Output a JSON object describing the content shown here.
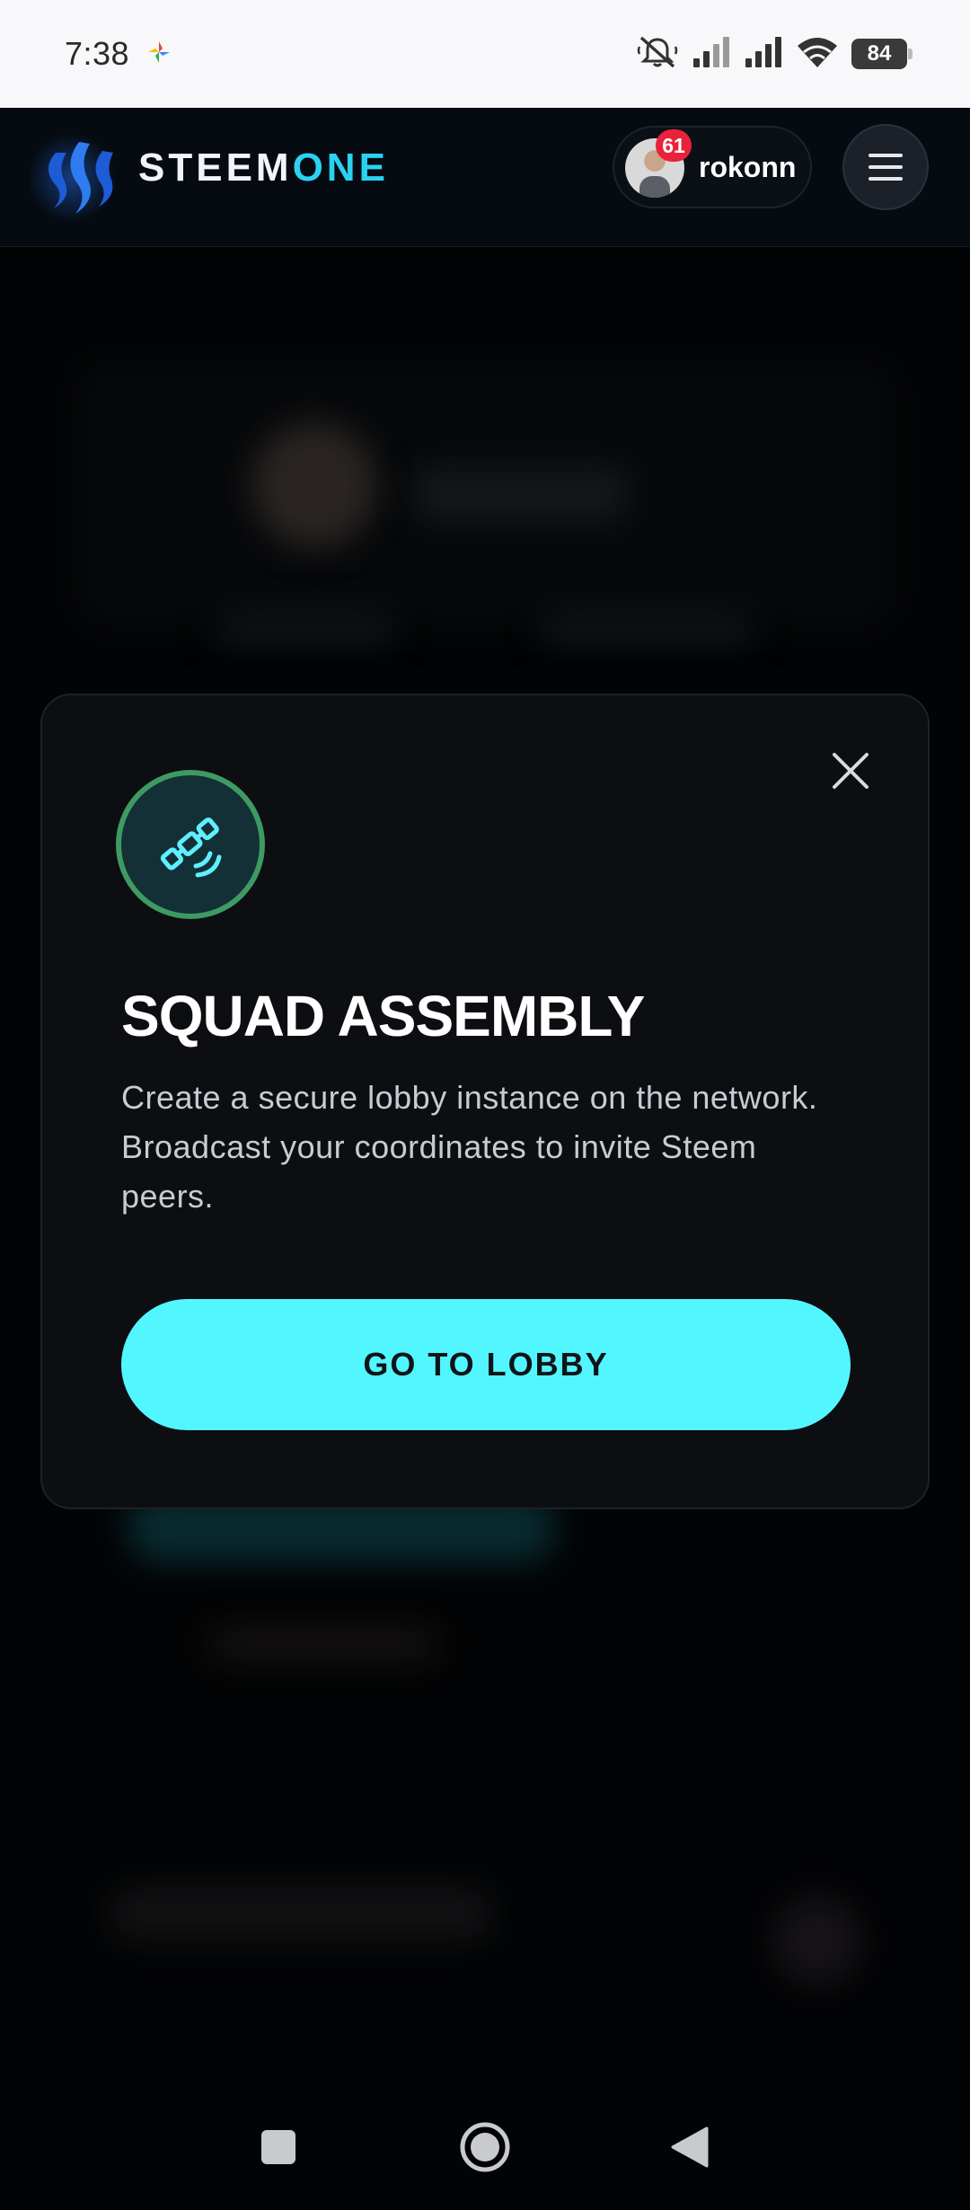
{
  "status_bar": {
    "time": "7:38",
    "battery": "84",
    "icons": [
      "pinwheel-icon",
      "mute-icon",
      "signal-icon",
      "signal-icon",
      "wifi-icon",
      "battery-icon"
    ]
  },
  "header": {
    "brand_part1": "STEEM",
    "brand_part2": "ONE",
    "notification_count": "61",
    "username": "rokonn",
    "colors": {
      "brand_accent": "#2ad2f0",
      "badge": "#e8223a"
    }
  },
  "modal": {
    "title": "SQUAD ASSEMBLY",
    "description": "Create a secure lobby instance on the network. Broadcast your coordinates to invite Steem peers.",
    "button_label": "GO TO LOBBY",
    "icon": "satellite-icon",
    "colors": {
      "button": "#52f6ff",
      "icon_ring": "#3f9a62",
      "icon_fg": "#5ff0ff"
    }
  },
  "nav_bar": {
    "items": [
      "recents-icon",
      "home-icon",
      "back-icon"
    ]
  }
}
